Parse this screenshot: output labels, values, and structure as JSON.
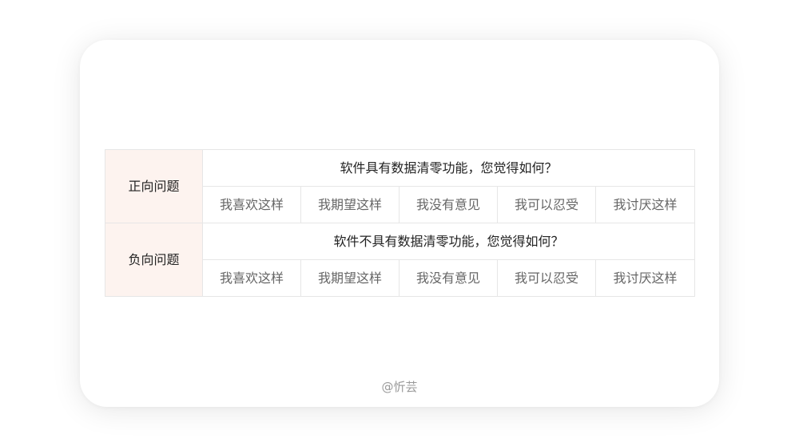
{
  "rows": [
    {
      "label": "正向问题",
      "question": "软件具有数据清零功能，您觉得如何？",
      "options": [
        "我喜欢这样",
        "我期望这样",
        "我没有意见",
        "我可以忍受",
        "我讨厌这样"
      ]
    },
    {
      "label": "负向问题",
      "question": "软件不具有数据清零功能，您觉得如何？",
      "options": [
        "我喜欢这样",
        "我期望这样",
        "我没有意见",
        "我可以忍受",
        "我讨厌这样"
      ]
    }
  ],
  "watermark": "@忻芸",
  "colors": {
    "label_bg": "#fdf3ef",
    "border": "#e6e6e6",
    "option_text": "#666666"
  }
}
